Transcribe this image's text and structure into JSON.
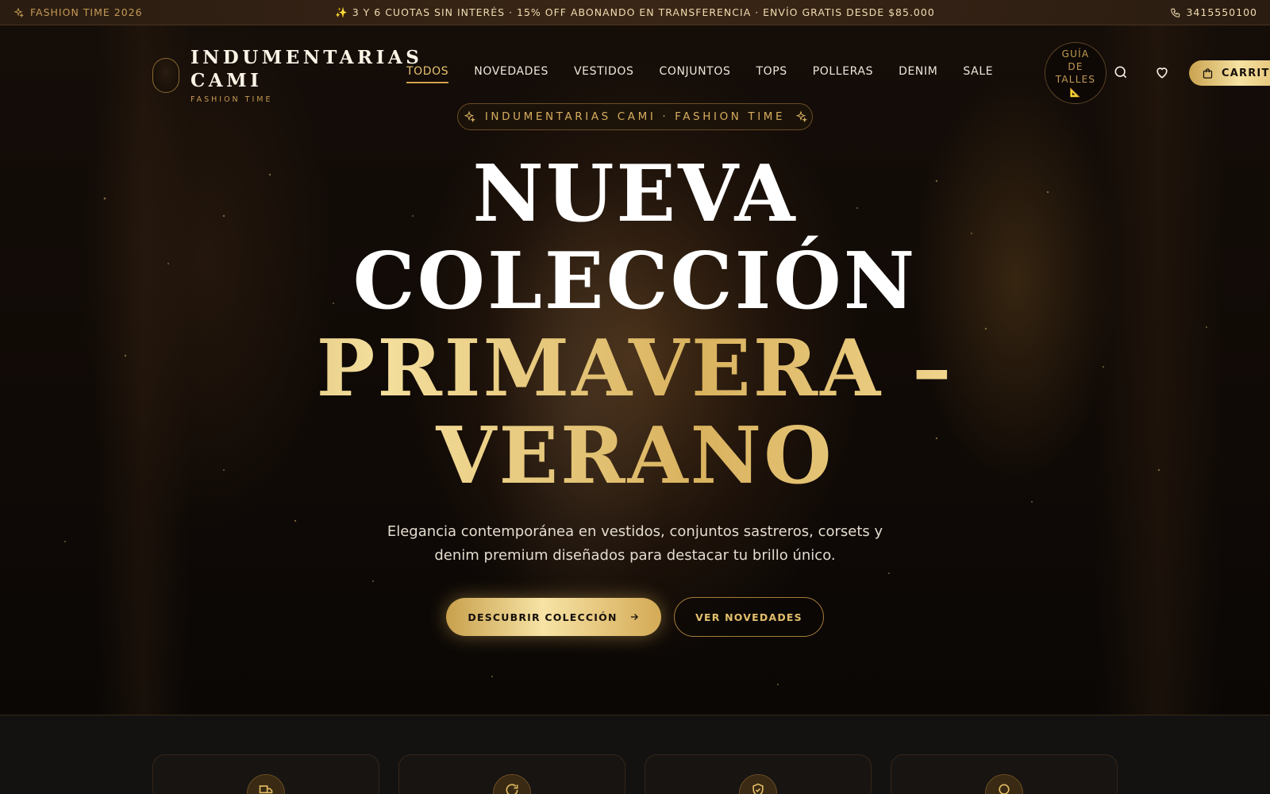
{
  "topbar": {
    "left_icon": "sparkle-icon",
    "left_text": "FASHION TIME 2026",
    "announcement": "✨ 3 Y 6 CUOTAS SIN INTERÉS · 15% OFF ABONANDO EN TRANSFERENCIA · ENVÍO GRATIS DESDE $85.000",
    "phone_icon": "phone-icon",
    "phone": "3415550100"
  },
  "brand": {
    "name_line1": "INDUMENTARIAS",
    "name_line2": "CAMI",
    "tagline": "FASHION TIME"
  },
  "nav": {
    "items": [
      {
        "label": "TODOS",
        "active": true
      },
      {
        "label": "NOVEDADES",
        "active": false
      },
      {
        "label": "VESTIDOS",
        "active": false
      },
      {
        "label": "CONJUNTOS",
        "active": false
      },
      {
        "label": "TOPS",
        "active": false
      },
      {
        "label": "POLLERAS",
        "active": false
      },
      {
        "label": "DENIM",
        "active": false
      },
      {
        "label": "SALE",
        "active": false
      }
    ]
  },
  "size_guide": {
    "line1": "GUÍA",
    "line2": "DE",
    "line3": "TALLES",
    "icon": "📐"
  },
  "header_icons": {
    "search": "search-icon",
    "wishlist": "heart-icon",
    "cart_icon": "bag-icon"
  },
  "cart": {
    "label": "CARRITO"
  },
  "hero": {
    "badge": "INDUMENTARIAS CAMI · FASHION TIME",
    "title_line1": "NUEVA",
    "title_line2": "COLECCIÓN",
    "title_line3": "PRIMAVERA –",
    "title_line4": "VERANO",
    "subtitle_line1": "Elegancia contemporánea en vestidos, conjuntos sastreros, corsets y",
    "subtitle_line2": "denim premium diseñados para destacar tu brillo único.",
    "cta_primary": "DESCUBRIR COLECCIÓN",
    "cta_secondary": "VER NOVEDADES"
  },
  "features": {
    "icons": [
      "truck-icon",
      "refresh-icon",
      "shield-check-icon",
      "chat-icon"
    ]
  },
  "colors": {
    "gold": "#d4a24c",
    "gold_light": "#f6e2a2",
    "background": "#0b0806",
    "topbar": "#2f2013"
  }
}
